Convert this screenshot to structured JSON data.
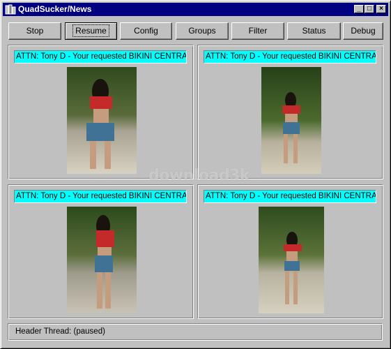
{
  "window": {
    "title": "QuadSucker/News"
  },
  "titlebar_buttons": {
    "minimize": "_",
    "maximize": "□",
    "close": "×"
  },
  "toolbar": [
    {
      "label": "Stop",
      "active": false
    },
    {
      "label": "Resume",
      "active": true
    },
    {
      "label": "Config",
      "active": false
    },
    {
      "label": "Groups",
      "active": false
    },
    {
      "label": "Filter",
      "active": false
    },
    {
      "label": "Status",
      "active": false
    },
    {
      "label": "Debug",
      "active": false
    }
  ],
  "panels": [
    {
      "caption": "ATTN: Tony D - Your requested BIKINI CENTRAL"
    },
    {
      "caption": "ATTN: Tony D - Your requested BIKINI CENTRAL"
    },
    {
      "caption": "ATTN: Tony D - Your requested BIKINI CENTRAL"
    },
    {
      "caption": "ATTN: Tony D - Your requested BIKINI CENTRAL"
    }
  ],
  "status": {
    "text": "Header Thread:  (paused)"
  },
  "watermark": "download3k",
  "colors": {
    "titlebar": "#000080",
    "caption_bg": "#00ffff",
    "face": "#c0c0c0"
  }
}
